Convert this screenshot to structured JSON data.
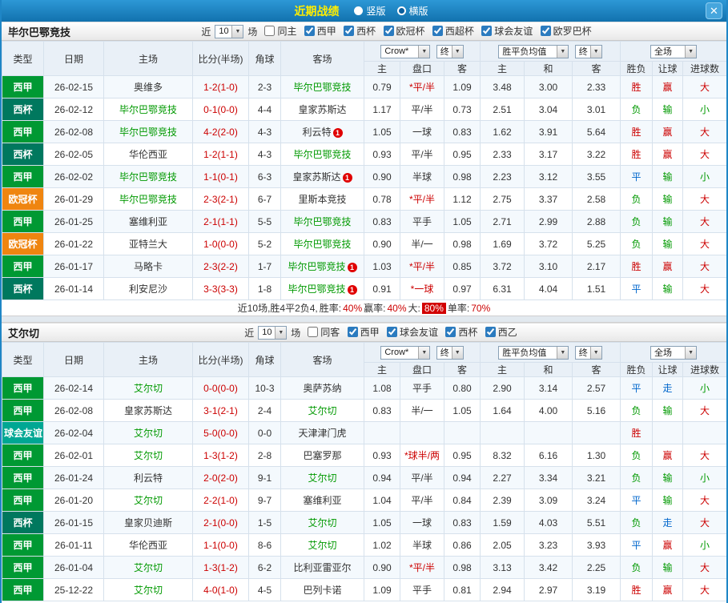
{
  "topbar": {
    "title": "近期战绩",
    "vertical_label": "竖版",
    "horizontal_label": "横版",
    "selected_layout": "横版",
    "close_glyph": "✕"
  },
  "colors": {
    "accent_blue": "#1f86c6",
    "win_red": "#cc0000",
    "lose_green": "#009900",
    "draw_blue": "#0066cc"
  },
  "columns": {
    "type": "类型",
    "date": "日期",
    "home": "主场",
    "score": "比分(半场)",
    "corner": "角球",
    "away": "客场",
    "sub": {
      "home_odds": "主",
      "handicap": "盘口",
      "away_odds": "客",
      "home_mean": "主",
      "draw_mean": "和",
      "away_mean": "客",
      "wdl": "胜负",
      "handicap_res": "让球",
      "goals": "进球数"
    }
  },
  "dropdowns": {
    "company": "Crow*",
    "stage_final": "终",
    "means": "胜平负均值",
    "scope": "全场"
  },
  "sections": [
    {
      "team": "毕尔巴鄂竞技",
      "filter": {
        "near_label": "近",
        "count": "10",
        "unit_label": "场",
        "checkboxes": [
          {
            "label": "同主",
            "checked": false
          },
          {
            "label": "西甲",
            "checked": true
          },
          {
            "label": "西杯",
            "checked": true
          },
          {
            "label": "欧冠杯",
            "checked": true
          },
          {
            "label": "西超杯",
            "checked": true
          },
          {
            "label": "球会友谊",
            "checked": true
          },
          {
            "label": "欧罗巴杯",
            "checked": true
          }
        ]
      },
      "rows": [
        {
          "type": "西甲",
          "type_color": "#009933",
          "date": "26-02-15",
          "home": "奥维多",
          "home_color": "#333333",
          "home_badge": "",
          "score": "1-2(1-0)",
          "corner": "2-3",
          "away": "毕尔巴鄂竞技",
          "away_color": "#009900",
          "away_badge": "",
          "odds_home": "0.79",
          "handicap": "*平/半",
          "handicap_color": "#cc0000",
          "odds_away": "1.09",
          "mean_home": "3.48",
          "mean_draw": "3.00",
          "mean_away": "2.33",
          "res_wdl": "胜",
          "res_wdl_color": "#cc0000",
          "res_cover": "赢",
          "res_cover_color": "#cc0000",
          "res_goals": "大",
          "res_goals_color": "#cc0000"
        },
        {
          "type": "西杯",
          "type_color": "#00785e",
          "date": "26-02-12",
          "home": "毕尔巴鄂竞技",
          "home_color": "#009900",
          "home_badge": "",
          "score": "0-1(0-0)",
          "corner": "4-4",
          "away": "皇家苏斯达",
          "away_color": "#333333",
          "away_badge": "",
          "odds_home": "1.17",
          "handicap": "平/半",
          "handicap_color": "#333333",
          "odds_away": "0.73",
          "mean_home": "2.51",
          "mean_draw": "3.04",
          "mean_away": "3.01",
          "res_wdl": "负",
          "res_wdl_color": "#009900",
          "res_cover": "输",
          "res_cover_color": "#009900",
          "res_goals": "小",
          "res_goals_color": "#009900"
        },
        {
          "type": "西甲",
          "type_color": "#009933",
          "date": "26-02-08",
          "home": "毕尔巴鄂竞技",
          "home_color": "#009900",
          "home_badge": "",
          "score": "4-2(2-0)",
          "corner": "4-3",
          "away": "利云特",
          "away_color": "#333333",
          "away_badge": "1",
          "odds_home": "1.05",
          "handicap": "一球",
          "handicap_color": "#333333",
          "odds_away": "0.83",
          "mean_home": "1.62",
          "mean_draw": "3.91",
          "mean_away": "5.64",
          "res_wdl": "胜",
          "res_wdl_color": "#cc0000",
          "res_cover": "赢",
          "res_cover_color": "#cc0000",
          "res_goals": "大",
          "res_goals_color": "#cc0000"
        },
        {
          "type": "西杯",
          "type_color": "#00785e",
          "date": "26-02-05",
          "home": "华伦西亚",
          "home_color": "#333333",
          "home_badge": "",
          "score": "1-2(1-1)",
          "corner": "4-3",
          "away": "毕尔巴鄂竞技",
          "away_color": "#009900",
          "away_badge": "",
          "odds_home": "0.93",
          "handicap": "平/半",
          "handicap_color": "#333333",
          "odds_away": "0.95",
          "mean_home": "2.33",
          "mean_draw": "3.17",
          "mean_away": "3.22",
          "res_wdl": "胜",
          "res_wdl_color": "#cc0000",
          "res_cover": "赢",
          "res_cover_color": "#cc0000",
          "res_goals": "大",
          "res_goals_color": "#cc0000"
        },
        {
          "type": "西甲",
          "type_color": "#009933",
          "date": "26-02-02",
          "home": "毕尔巴鄂竞技",
          "home_color": "#009900",
          "home_badge": "",
          "score": "1-1(0-1)",
          "corner": "6-3",
          "away": "皇家苏斯达",
          "away_color": "#333333",
          "away_badge": "1",
          "odds_home": "0.90",
          "handicap": "半球",
          "handicap_color": "#333333",
          "odds_away": "0.98",
          "mean_home": "2.23",
          "mean_draw": "3.12",
          "mean_away": "3.55",
          "res_wdl": "平",
          "res_wdl_color": "#0066cc",
          "res_cover": "输",
          "res_cover_color": "#009900",
          "res_goals": "小",
          "res_goals_color": "#009900"
        },
        {
          "type": "欧冠杯",
          "type_color": "#ef8510",
          "date": "26-01-29",
          "home": "毕尔巴鄂竞技",
          "home_color": "#009900",
          "home_badge": "",
          "score": "2-3(2-1)",
          "corner": "6-7",
          "away": "里斯本竞技",
          "away_color": "#333333",
          "away_badge": "",
          "odds_home": "0.78",
          "handicap": "*平/半",
          "handicap_color": "#cc0000",
          "odds_away": "1.12",
          "mean_home": "2.75",
          "mean_draw": "3.37",
          "mean_away": "2.58",
          "res_wdl": "负",
          "res_wdl_color": "#009900",
          "res_cover": "输",
          "res_cover_color": "#009900",
          "res_goals": "大",
          "res_goals_color": "#cc0000"
        },
        {
          "type": "西甲",
          "type_color": "#009933",
          "date": "26-01-25",
          "home": "塞维利亚",
          "home_color": "#333333",
          "home_badge": "",
          "score": "2-1(1-1)",
          "corner": "5-5",
          "away": "毕尔巴鄂竞技",
          "away_color": "#009900",
          "away_badge": "",
          "odds_home": "0.83",
          "handicap": "平手",
          "handicap_color": "#333333",
          "odds_away": "1.05",
          "mean_home": "2.71",
          "mean_draw": "2.99",
          "mean_away": "2.88",
          "res_wdl": "负",
          "res_wdl_color": "#009900",
          "res_cover": "输",
          "res_cover_color": "#009900",
          "res_goals": "大",
          "res_goals_color": "#cc0000"
        },
        {
          "type": "欧冠杯",
          "type_color": "#ef8510",
          "date": "26-01-22",
          "home": "亚特兰大",
          "home_color": "#333333",
          "home_badge": "",
          "score": "1-0(0-0)",
          "corner": "5-2",
          "away": "毕尔巴鄂竞技",
          "away_color": "#009900",
          "away_badge": "",
          "odds_home": "0.90",
          "handicap": "半/一",
          "handicap_color": "#333333",
          "odds_away": "0.98",
          "mean_home": "1.69",
          "mean_draw": "3.72",
          "mean_away": "5.25",
          "res_wdl": "负",
          "res_wdl_color": "#009900",
          "res_cover": "输",
          "res_cover_color": "#009900",
          "res_goals": "大",
          "res_goals_color": "#cc0000"
        },
        {
          "type": "西甲",
          "type_color": "#009933",
          "date": "26-01-17",
          "home": "马略卡",
          "home_color": "#333333",
          "home_badge": "",
          "score": "2-3(2-2)",
          "corner": "1-7",
          "away": "毕尔巴鄂竞技",
          "away_color": "#009900",
          "away_badge": "1",
          "odds_home": "1.03",
          "handicap": "*平/半",
          "handicap_color": "#cc0000",
          "odds_away": "0.85",
          "mean_home": "3.72",
          "mean_draw": "3.10",
          "mean_away": "2.17",
          "res_wdl": "胜",
          "res_wdl_color": "#cc0000",
          "res_cover": "赢",
          "res_cover_color": "#cc0000",
          "res_goals": "大",
          "res_goals_color": "#cc0000"
        },
        {
          "type": "西杯",
          "type_color": "#00785e",
          "date": "26-01-14",
          "home": "利安尼沙",
          "home_color": "#333333",
          "home_badge": "",
          "score": "3-3(3-3)",
          "corner": "1-8",
          "away": "毕尔巴鄂竞技",
          "away_color": "#009900",
          "away_badge": "1",
          "odds_home": "0.91",
          "handicap": "*一球",
          "handicap_color": "#cc0000",
          "odds_away": "0.97",
          "mean_home": "6.31",
          "mean_draw": "4.04",
          "mean_away": "1.51",
          "res_wdl": "平",
          "res_wdl_color": "#0066cc",
          "res_cover": "输",
          "res_cover_color": "#009900",
          "res_goals": "大",
          "res_goals_color": "#cc0000"
        }
      ],
      "summary": {
        "prefix": "近10场,胜4平2负4,",
        "win_rate_label": "胜率:",
        "win_rate": "40%",
        "cover_label": "赢率:",
        "cover_rate": "40%",
        "big_label": "大:",
        "big_rate": "80%",
        "odd_label": "单率:",
        "odd_rate": "70%"
      }
    },
    {
      "team": "艾尔切",
      "filter": {
        "near_label": "近",
        "count": "10",
        "unit_label": "场",
        "checkboxes": [
          {
            "label": "同客",
            "checked": false
          },
          {
            "label": "西甲",
            "checked": true
          },
          {
            "label": "球会友谊",
            "checked": true
          },
          {
            "label": "西杯",
            "checked": true
          },
          {
            "label": "西乙",
            "checked": true
          }
        ]
      },
      "rows": [
        {
          "type": "西甲",
          "type_color": "#009933",
          "date": "26-02-14",
          "home": "艾尔切",
          "home_color": "#009900",
          "home_badge": "",
          "score": "0-0(0-0)",
          "corner": "10-3",
          "away": "奥萨苏纳",
          "away_color": "#333333",
          "away_badge": "",
          "odds_home": "1.08",
          "handicap": "平手",
          "handicap_color": "#333333",
          "odds_away": "0.80",
          "mean_home": "2.90",
          "mean_draw": "3.14",
          "mean_away": "2.57",
          "res_wdl": "平",
          "res_wdl_color": "#0066cc",
          "res_cover": "走",
          "res_cover_color": "#0066cc",
          "res_goals": "小",
          "res_goals_color": "#009900"
        },
        {
          "type": "西甲",
          "type_color": "#009933",
          "date": "26-02-08",
          "home": "皇家苏斯达",
          "home_color": "#333333",
          "home_badge": "",
          "score": "3-1(2-1)",
          "corner": "2-4",
          "away": "艾尔切",
          "away_color": "#009900",
          "away_badge": "",
          "odds_home": "0.83",
          "handicap": "半/一",
          "handicap_color": "#333333",
          "odds_away": "1.05",
          "mean_home": "1.64",
          "mean_draw": "4.00",
          "mean_away": "5.16",
          "res_wdl": "负",
          "res_wdl_color": "#009900",
          "res_cover": "输",
          "res_cover_color": "#009900",
          "res_goals": "大",
          "res_goals_color": "#cc0000"
        },
        {
          "type": "球会友谊",
          "type_color": "#00a793",
          "date": "26-02-04",
          "home": "艾尔切",
          "home_color": "#009900",
          "home_badge": "",
          "score": "5-0(0-0)",
          "corner": "0-0",
          "away": "天津津门虎",
          "away_color": "#333333",
          "away_badge": "",
          "odds_home": "",
          "handicap": "",
          "handicap_color": "#333333",
          "odds_away": "",
          "mean_home": "",
          "mean_draw": "",
          "mean_away": "",
          "res_wdl": "胜",
          "res_wdl_color": "#cc0000",
          "res_cover": "",
          "res_cover_color": "#333333",
          "res_goals": "",
          "res_goals_color": "#333333"
        },
        {
          "type": "西甲",
          "type_color": "#009933",
          "date": "26-02-01",
          "home": "艾尔切",
          "home_color": "#009900",
          "home_badge": "",
          "score": "1-3(1-2)",
          "corner": "2-8",
          "away": "巴塞罗那",
          "away_color": "#333333",
          "away_badge": "",
          "odds_home": "0.93",
          "handicap": "*球半/两",
          "handicap_color": "#cc0000",
          "odds_away": "0.95",
          "mean_home": "8.32",
          "mean_draw": "6.16",
          "mean_away": "1.30",
          "res_wdl": "负",
          "res_wdl_color": "#009900",
          "res_cover": "赢",
          "res_cover_color": "#cc0000",
          "res_goals": "大",
          "res_goals_color": "#cc0000"
        },
        {
          "type": "西甲",
          "type_color": "#009933",
          "date": "26-01-24",
          "home": "利云特",
          "home_color": "#333333",
          "home_badge": "",
          "score": "2-0(2-0)",
          "corner": "9-1",
          "away": "艾尔切",
          "away_color": "#009900",
          "away_badge": "",
          "odds_home": "0.94",
          "handicap": "平/半",
          "handicap_color": "#333333",
          "odds_away": "0.94",
          "mean_home": "2.27",
          "mean_draw": "3.34",
          "mean_away": "3.21",
          "res_wdl": "负",
          "res_wdl_color": "#009900",
          "res_cover": "输",
          "res_cover_color": "#009900",
          "res_goals": "小",
          "res_goals_color": "#009900"
        },
        {
          "type": "西甲",
          "type_color": "#009933",
          "date": "26-01-20",
          "home": "艾尔切",
          "home_color": "#009900",
          "home_badge": "",
          "score": "2-2(1-0)",
          "corner": "9-7",
          "away": "塞维利亚",
          "away_color": "#333333",
          "away_badge": "",
          "odds_home": "1.04",
          "handicap": "平/半",
          "handicap_color": "#333333",
          "odds_away": "0.84",
          "mean_home": "2.39",
          "mean_draw": "3.09",
          "mean_away": "3.24",
          "res_wdl": "平",
          "res_wdl_color": "#0066cc",
          "res_cover": "输",
          "res_cover_color": "#009900",
          "res_goals": "大",
          "res_goals_color": "#cc0000"
        },
        {
          "type": "西杯",
          "type_color": "#00785e",
          "date": "26-01-15",
          "home": "皇家贝迪斯",
          "home_color": "#333333",
          "home_badge": "",
          "score": "2-1(0-0)",
          "corner": "1-5",
          "away": "艾尔切",
          "away_color": "#009900",
          "away_badge": "",
          "odds_home": "1.05",
          "handicap": "一球",
          "handicap_color": "#333333",
          "odds_away": "0.83",
          "mean_home": "1.59",
          "mean_draw": "4.03",
          "mean_away": "5.51",
          "res_wdl": "负",
          "res_wdl_color": "#009900",
          "res_cover": "走",
          "res_cover_color": "#0066cc",
          "res_goals": "大",
          "res_goals_color": "#cc0000"
        },
        {
          "type": "西甲",
          "type_color": "#009933",
          "date": "26-01-11",
          "home": "华伦西亚",
          "home_color": "#333333",
          "home_badge": "",
          "score": "1-1(0-0)",
          "corner": "8-6",
          "away": "艾尔切",
          "away_color": "#009900",
          "away_badge": "",
          "odds_home": "1.02",
          "handicap": "半球",
          "handicap_color": "#333333",
          "odds_away": "0.86",
          "mean_home": "2.05",
          "mean_draw": "3.23",
          "mean_away": "3.93",
          "res_wdl": "平",
          "res_wdl_color": "#0066cc",
          "res_cover": "赢",
          "res_cover_color": "#cc0000",
          "res_goals": "小",
          "res_goals_color": "#009900"
        },
        {
          "type": "西甲",
          "type_color": "#009933",
          "date": "26-01-04",
          "home": "艾尔切",
          "home_color": "#009900",
          "home_badge": "",
          "score": "1-3(1-2)",
          "corner": "6-2",
          "away": "比利亚雷亚尔",
          "away_color": "#333333",
          "away_badge": "",
          "odds_home": "0.90",
          "handicap": "*平/半",
          "handicap_color": "#cc0000",
          "odds_away": "0.98",
          "mean_home": "3.13",
          "mean_draw": "3.42",
          "mean_away": "2.25",
          "res_wdl": "负",
          "res_wdl_color": "#009900",
          "res_cover": "输",
          "res_cover_color": "#009900",
          "res_goals": "大",
          "res_goals_color": "#cc0000"
        },
        {
          "type": "西甲",
          "type_color": "#009933",
          "date": "25-12-22",
          "home": "艾尔切",
          "home_color": "#009900",
          "home_badge": "",
          "score": "4-0(1-0)",
          "corner": "4-5",
          "away": "巴列卡诺",
          "away_color": "#333333",
          "away_badge": "",
          "odds_home": "1.09",
          "handicap": "平手",
          "handicap_color": "#333333",
          "odds_away": "0.81",
          "mean_home": "2.94",
          "mean_draw": "2.97",
          "mean_away": "3.19",
          "res_wdl": "胜",
          "res_wdl_color": "#cc0000",
          "res_cover": "赢",
          "res_cover_color": "#cc0000",
          "res_goals": "大",
          "res_goals_color": "#cc0000"
        }
      ]
    }
  ]
}
